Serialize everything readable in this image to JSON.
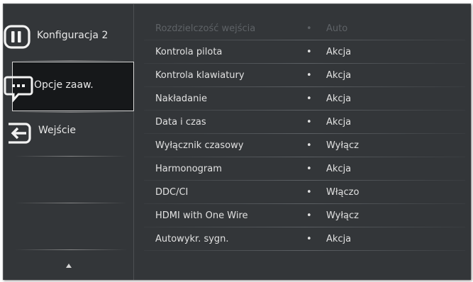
{
  "sidebar": {
    "items": [
      {
        "label": "Konfiguracja 2",
        "icon": "configuration-icon"
      },
      {
        "label": "Opcje zaaw.",
        "icon": "advanced-options-icon",
        "selected": true
      },
      {
        "label": "Wejście",
        "icon": "input-icon"
      }
    ],
    "scroll_icon": "triangle-up-icon"
  },
  "settings": [
    {
      "name": "Rozdzielczość wejścia",
      "value": "Auto",
      "enabled": false
    },
    {
      "name": "Kontrola pilota",
      "value": "Akcja",
      "enabled": true
    },
    {
      "name": "Kontrola klawiatury",
      "value": "Akcja",
      "enabled": true
    },
    {
      "name": "Nakładanie",
      "value": "Akcja",
      "enabled": true
    },
    {
      "name": "Data i czas",
      "value": "Akcja",
      "enabled": true
    },
    {
      "name": "Wyłącznik czasowy",
      "value": "Wyłącz",
      "enabled": true
    },
    {
      "name": "Harmonogram",
      "value": "Akcja",
      "enabled": true
    },
    {
      "name": "DDC/CI",
      "value": "Włączo",
      "enabled": true
    },
    {
      "name": "HDMI with One Wire",
      "value": "Wyłącz",
      "enabled": true
    },
    {
      "name": "Autowykr. sygn.",
      "value": "Akcja",
      "enabled": true
    }
  ],
  "bullet": "•",
  "colors": {
    "background": "#333639",
    "text": "#e1e1e1",
    "disabled_text": "#5e6266",
    "selected_bg": "#16181a",
    "selected_border": "#d8d8d8"
  }
}
